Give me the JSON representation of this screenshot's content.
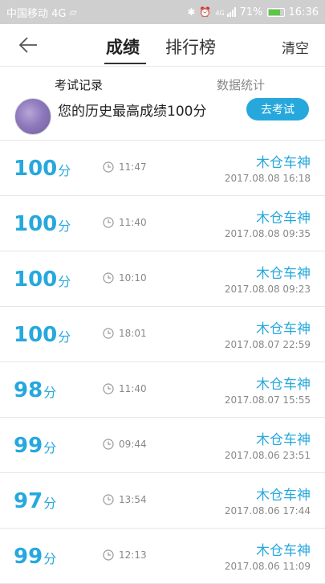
{
  "status_bar": {
    "carrier": "中国移动 4G",
    "battery_percent": "71%",
    "time": "16:36",
    "network": "4G"
  },
  "nav": {
    "active_tab": "成绩",
    "other_tab": "排行榜",
    "clear_label": "清空"
  },
  "subtabs": {
    "active": "考试记录",
    "inactive": "数据统计"
  },
  "best": {
    "text": "您的历史最高成绩100分",
    "button": "去考试"
  },
  "unit": "分",
  "records": [
    {
      "score": "100",
      "duration": "11:47",
      "name": "木仓车神",
      "date": "2017.08.08  16:18"
    },
    {
      "score": "100",
      "duration": "11:40",
      "name": "木仓车神",
      "date": "2017.08.08  09:35"
    },
    {
      "score": "100",
      "duration": "10:10",
      "name": "木仓车神",
      "date": "2017.08.08  09:23"
    },
    {
      "score": "100",
      "duration": "18:01",
      "name": "木仓车神",
      "date": "2017.08.07  22:59"
    },
    {
      "score": "98",
      "duration": "11:40",
      "name": "木仓车神",
      "date": "2017.08.07  15:55"
    },
    {
      "score": "99",
      "duration": "09:44",
      "name": "木仓车神",
      "date": "2017.08.06  23:51"
    },
    {
      "score": "97",
      "duration": "13:54",
      "name": "木仓车神",
      "date": "2017.08.06  17:44"
    },
    {
      "score": "99",
      "duration": "12:13",
      "name": "木仓车神",
      "date": "2017.08.06  11:09"
    }
  ],
  "colors": {
    "accent": "#26a8dd",
    "status_bar": "#cfcfcf",
    "battery_fill": "#58c940"
  },
  "icons": {
    "back": "arrow-left-icon",
    "clock": "clock-icon"
  }
}
